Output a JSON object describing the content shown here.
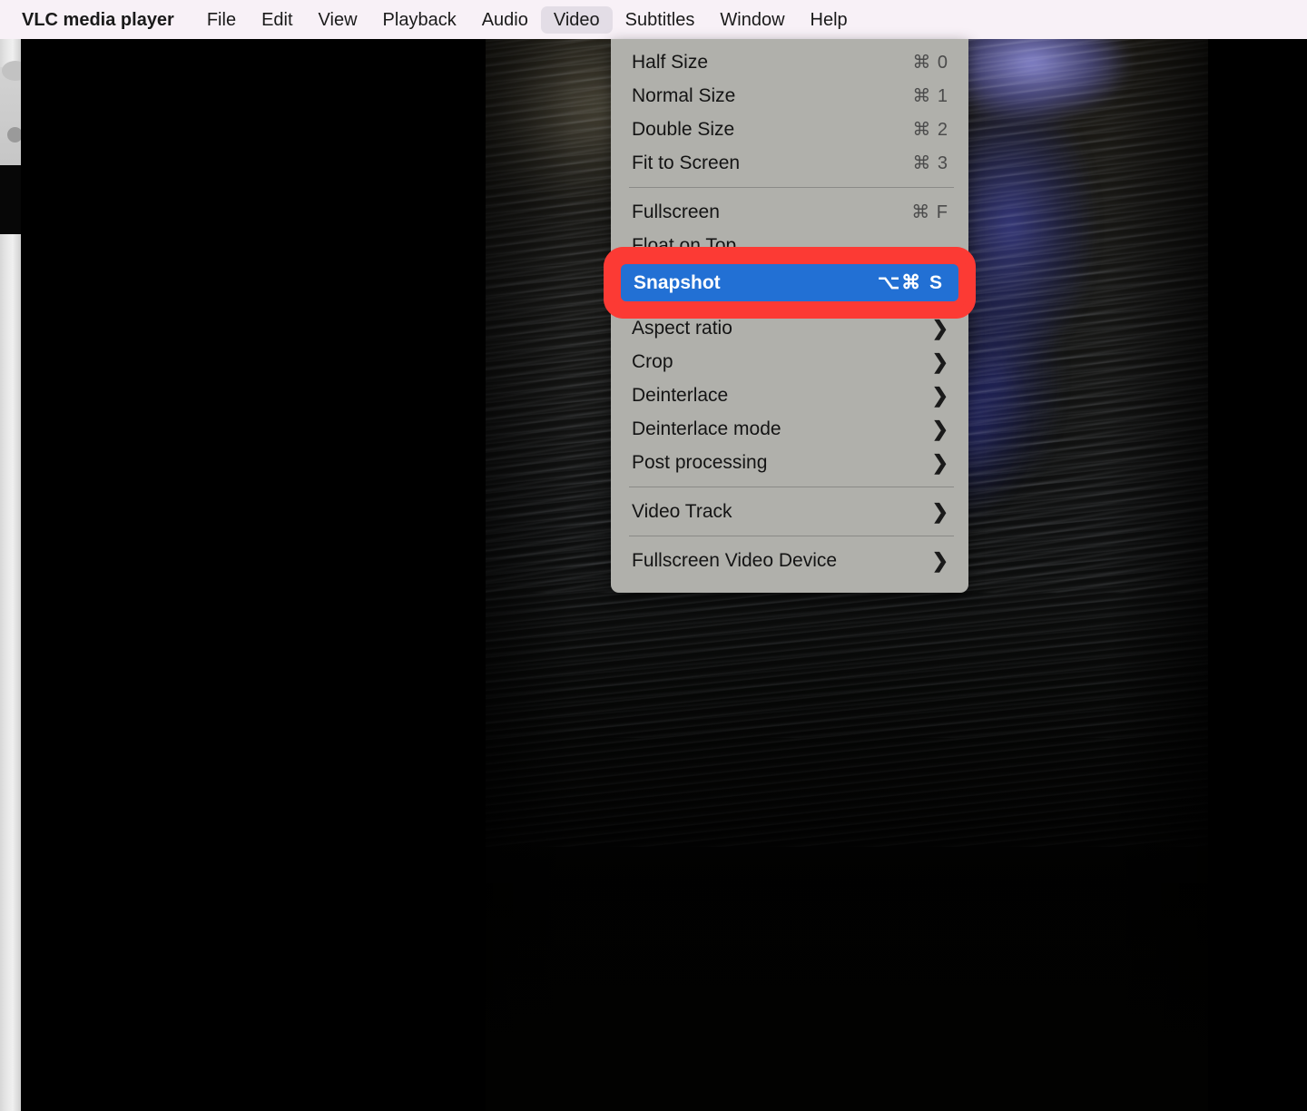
{
  "menubar": {
    "app_name": "VLC media player",
    "items": [
      {
        "label": "File",
        "active": false
      },
      {
        "label": "Edit",
        "active": false
      },
      {
        "label": "View",
        "active": false
      },
      {
        "label": "Playback",
        "active": false
      },
      {
        "label": "Audio",
        "active": false
      },
      {
        "label": "Video",
        "active": true
      },
      {
        "label": "Subtitles",
        "active": false
      },
      {
        "label": "Window",
        "active": false
      },
      {
        "label": "Help",
        "active": false
      }
    ],
    "background_color": "#f8f1f7",
    "active_item_color": "#e3dde6"
  },
  "video_menu": {
    "title": "Video",
    "background_color": "#b0b0ab",
    "groups": [
      {
        "items": [
          {
            "label": "Half Size",
            "accel": "⌘ 0",
            "submenu": false
          },
          {
            "label": "Normal Size",
            "accel": "⌘ 1",
            "submenu": false
          },
          {
            "label": "Double Size",
            "accel": "⌘ 2",
            "submenu": false
          },
          {
            "label": "Fit to Screen",
            "accel": "⌘ 3",
            "submenu": false
          }
        ]
      },
      {
        "items": [
          {
            "label": "Fullscreen",
            "accel": "⌘ F",
            "submenu": false
          },
          {
            "label": "Float on Top",
            "accel": "",
            "submenu": false
          },
          {
            "label": "Snapshot",
            "accel": "⌥⌘ S",
            "submenu": false,
            "highlighted": true
          }
        ]
      },
      {
        "items": [
          {
            "label": "Aspect ratio",
            "accel": "",
            "submenu": true
          },
          {
            "label": "Crop",
            "accel": "",
            "submenu": true
          },
          {
            "label": "Deinterlace",
            "accel": "",
            "submenu": true
          },
          {
            "label": "Deinterlace mode",
            "accel": "",
            "submenu": true
          },
          {
            "label": "Post processing",
            "accel": "",
            "submenu": true
          }
        ]
      },
      {
        "items": [
          {
            "label": "Video Track",
            "accel": "",
            "submenu": true
          }
        ]
      },
      {
        "items": [
          {
            "label": "Fullscreen Video Device",
            "accel": "",
            "submenu": true
          }
        ]
      }
    ],
    "selected_item": {
      "label": "Snapshot",
      "accel": "⌥⌘ S",
      "selection_color": "#2270d4",
      "text_color": "#ffffff"
    },
    "submenu_chevron": "❯"
  },
  "annotation": {
    "type": "highlight-rectangle",
    "target": "Snapshot",
    "color": "#fc3a34"
  },
  "video_surface": {
    "description": "dark night water with blue light reflection",
    "background_color": "#000000"
  }
}
